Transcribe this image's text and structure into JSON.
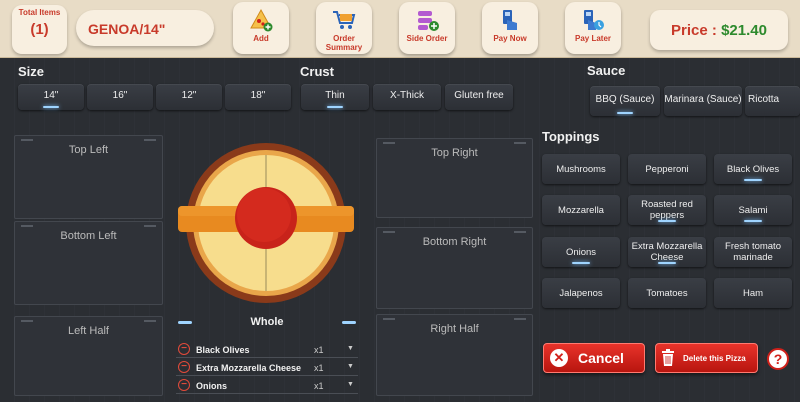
{
  "header": {
    "total_label": "Total Items",
    "total_count": "(1)",
    "pizza_name": "GENOA/14\"",
    "buttons": [
      {
        "label": "Add",
        "icon": "pizza-add-icon"
      },
      {
        "label": "Order Summary",
        "icon": "cart-icon"
      },
      {
        "label": "Side Order",
        "icon": "side-order-icon"
      },
      {
        "label": "Pay Now",
        "icon": "pay-now-icon"
      },
      {
        "label": "Pay Later",
        "icon": "pay-later-icon"
      }
    ],
    "price_label": "Price : ",
    "price_value": "$21.40"
  },
  "size": {
    "title": "Size",
    "options": [
      "14\"",
      "16\"",
      "12\"",
      "18\""
    ],
    "selected": "14\""
  },
  "crust": {
    "title": "Crust",
    "options": [
      "Thin",
      "X-Thick",
      "Gluten free"
    ],
    "selected": "Thin"
  },
  "sauce": {
    "title": "Sauce",
    "options": [
      "BBQ (Sauce)",
      "Marinara (Sauce)",
      "Ricotta"
    ],
    "selected": "BBQ (Sauce)"
  },
  "sections": {
    "top_left": "Top Left",
    "bottom_left": "Bottom Left",
    "left_half": "Left Half",
    "top_right": "Top Right",
    "bottom_right": "Bottom Right",
    "right_half": "Right Half"
  },
  "whole": {
    "title": "Whole",
    "items": [
      {
        "name": "Black Olives",
        "qty": "x1"
      },
      {
        "name": "Extra Mozzarella Cheese",
        "qty": "x1"
      },
      {
        "name": "Onions",
        "qty": "x1"
      }
    ]
  },
  "toppings": {
    "title": "Toppings",
    "items": [
      {
        "label": "Mushrooms",
        "selected": false
      },
      {
        "label": "Pepperoni",
        "selected": false
      },
      {
        "label": "Black Olives",
        "selected": true
      },
      {
        "label": "Mozzarella",
        "selected": false
      },
      {
        "label": "Roasted red peppers",
        "selected": true
      },
      {
        "label": "Salami",
        "selected": true
      },
      {
        "label": "Onions",
        "selected": true
      },
      {
        "label": "Extra Mozzarella Cheese",
        "selected": true
      },
      {
        "label": "Fresh tomato marinade",
        "selected": false
      },
      {
        "label": "Jalapenos",
        "selected": false
      },
      {
        "label": "Tomatoes",
        "selected": false
      },
      {
        "label": "Ham",
        "selected": false
      }
    ]
  },
  "actions": {
    "cancel": "Cancel",
    "delete": "Delete this Pizza",
    "help": "?"
  },
  "colors": {
    "accent_red": "#c83a2a",
    "price_green": "#2d8a2d",
    "header_bg": "#e8dcc6",
    "selected_glow": "#9fd4ff"
  }
}
